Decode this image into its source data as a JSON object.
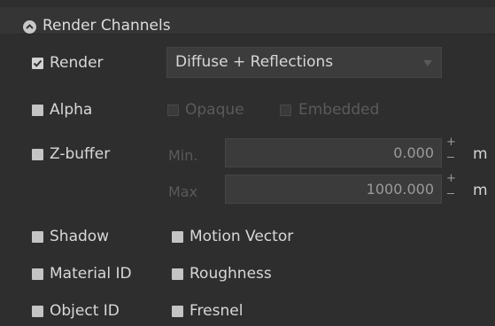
{
  "section": {
    "title": "Render Channels",
    "collapse_icon": "chevron-up-circle-icon"
  },
  "render": {
    "label": "Render",
    "checked": true,
    "dropdown": {
      "value": "Diffuse + Reflections"
    }
  },
  "alpha": {
    "label": "Alpha",
    "checked": false,
    "options": [
      {
        "label": "Opaque",
        "enabled": false
      },
      {
        "label": "Embedded",
        "enabled": false
      }
    ]
  },
  "zbuffer": {
    "label": "Z-buffer",
    "checked": false,
    "min": {
      "label": "Min.",
      "value": "0.000",
      "unit": "m"
    },
    "max": {
      "label": "Max",
      "value": "1000.000",
      "unit": "m"
    }
  },
  "channels_left": [
    {
      "label": "Shadow",
      "checked": false
    },
    {
      "label": "Material ID",
      "checked": false
    },
    {
      "label": "Object ID",
      "checked": false
    }
  ],
  "channels_right": [
    {
      "label": "Motion Vector",
      "checked": false
    },
    {
      "label": "Roughness",
      "checked": false
    },
    {
      "label": "Fresnel",
      "checked": false
    }
  ],
  "stepper_glyph": "+",
  "colors": {
    "panel_bg": "#2e2e2e",
    "header_bg": "#353535",
    "field_bg": "#3b3b3b",
    "text": "#d6d6d6",
    "disabled_text": "#5a5a5a"
  }
}
